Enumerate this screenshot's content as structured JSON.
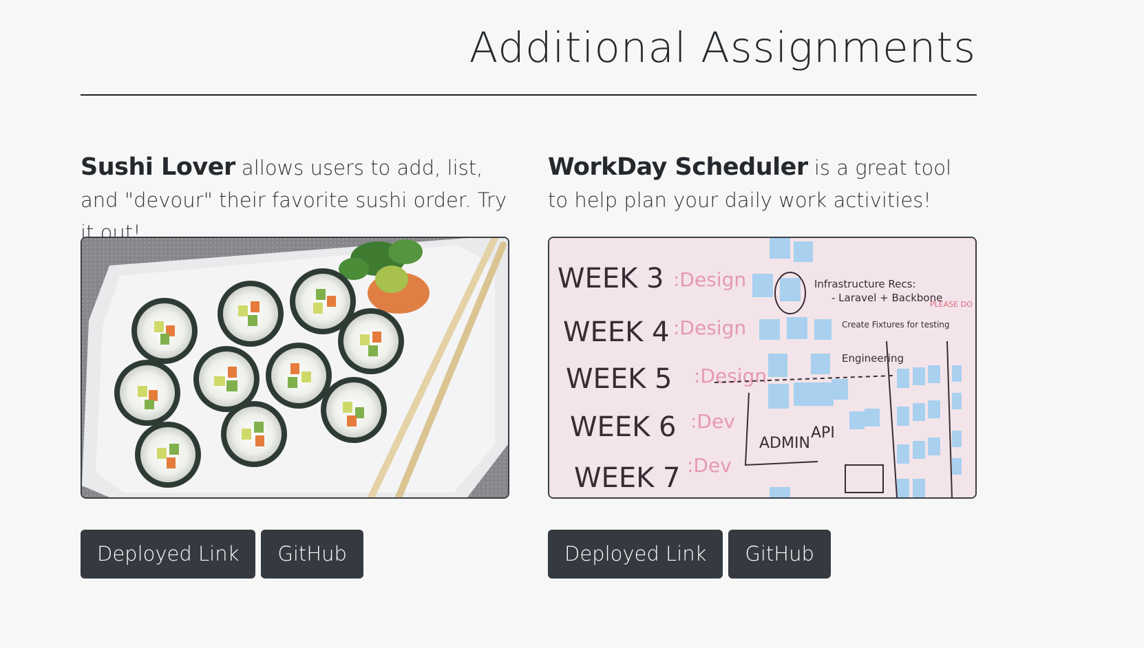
{
  "section": {
    "title": "Additional Assignments"
  },
  "projects": [
    {
      "name": "Sushi Lover",
      "description": " allows users to add, list, and \"devour\" their favorite sushi order. Try it out!",
      "deployed_label": "Deployed Link",
      "github_label": "GitHub"
    },
    {
      "name": "WorkDay Scheduler",
      "description": " is a great tool to help plan your daily work activities!",
      "deployed_label": "Deployed Link",
      "github_label": "GitHub",
      "whiteboard": {
        "weeks": [
          "WEEK 3",
          "WEEK 4",
          "WEEK 5",
          "WEEK 6",
          "WEEK 7"
        ],
        "tags": [
          ":Design",
          ":Design",
          ":Design",
          ":Dev",
          ":Dev"
        ],
        "notes": [
          "Infrastructure Recs:",
          "- Laravel + Backbone",
          "Create Fixtures for testing",
          "Engineering",
          "ADMIN",
          "API",
          "PLEASE DO NOT ERASE"
        ]
      }
    }
  ],
  "colors": {
    "background": "#f6f7f6",
    "button": "#343a40",
    "button_text": "#ffffff",
    "text": "#2b2f33"
  }
}
